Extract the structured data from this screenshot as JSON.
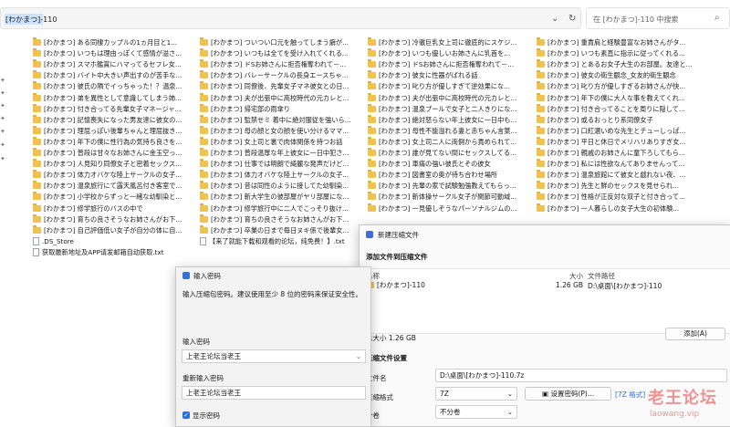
{
  "explorer": {
    "address_selected": "[わかまつ]",
    "address_rest": "-110",
    "search_placeholder": "在 [わかまつ]-110 中搜索",
    "icons": [
      "chevron-down-icon",
      "refresh-icon",
      "search-icon"
    ]
  },
  "files": {
    "col1": [
      "[わかまつ] ある同棲カップルの1ヵ月目と1...",
      "[わかまつ] いつもは理由っぽくて感情が溢さ...",
      "[わかまつ] スマホ鑑賞にハマってるセフレ女...",
      "[わかまつ] バイト中大きい声出すのが苦手な...",
      "[わかまつ] 彼氏の隣でイっちゃった！？温泉...",
      "[わかまつ] 弟を異性として意識してしまう姉...",
      "[わかまつ] 付き合ってる先輩女子マネージャ...",
      "[わかまつ] 記憶喪失になった男友達に彼女の...",
      "[わかまつ] 理屈っぽい後輩ちゃんと理屈抜き...",
      "[わかまつ] 年下の僕に性行為の気持ち良さを...",
      "[わかまつ] 普段は甘々なお姉さんに金玉空っ...",
      "[わかまつ] 人見知り同僚女子と密着セックス...",
      "[わかまつ] 体力オバケな陸上サークルの女子...",
      "[わかまつ] 温泉旅行にて露天風呂付き客室で...",
      "[わかまつ] 小学校からずっと一緒な幼馴染と...",
      "[わかまつ] 修学旅行のバスの中で",
      "[わかまつ] 育ちの良さそうなお姉さんがお下...",
      "[わかまつ] 自己評価低い女子が自分の体に自..."
    ],
    "col1_extra": [
      ".DS_Store",
      "获取最新地址及APP请发邮箱自动获取.txt"
    ],
    "col2": [
      "[わかまつ] ついつい口元を触ってしまう癖が...",
      "[わかまつ] いつもは全てを受け入れてくれる...",
      "[わかまつ] ドSお姉さんに拒否権奪われて－...",
      "[わかまつ] バレーサークルの長身エースちゃ...",
      "[わかまつ] 同僚後、先輩女子マネ彼女との日...",
      "[わかまつ] 夫が出張中に高校時代の元カレと...",
      "[わかまつ] 帰宅部の雨傘り",
      "[わかまつ] 監禁せミ 着中に絶対服従を強いら...",
      "[わかまつ] 母の顔と女の顔を使い分けるママ...",
      "[わかまつ] 女上司と裏で肉体関係を持つお話",
      "[わかまつ] 普段温厚な年上彼女に一日中犯さ...",
      "[わかまつ] 仕事では明朗で綺麗な発声だけど...",
      "[わかまつ] 体力オバケな陸上サークルの女子...",
      "[わかまつ] 昔は同性のように接してた幼馴染...",
      "[わかまつ] 新大学生の彼部屋がヤリ部屋にな...",
      "[わかまつ] 修学旅行中に二人でこっそり抜け...",
      "[わかまつ] 育ちの良さそうなお姉さんがお下...",
      "[わかまつ] 卒業の日まで毎日ヌキ係で後輩女..."
    ],
    "col2_extra": "【来了就能下载和观看的论坛，纯免费！】.txt",
    "col3": [
      "[わかまつ] 冷徹巨乳女上司に徹底的にスケジ...",
      "[わかまつ] いつも優しいお姉さんに乳首を...",
      "[わかまつ] ドSお姉さんに拒否権奪われて－...",
      "[わかまつ] 彼女に性器がばれる話",
      "[わかまつ] 叱り方が優しすぎて逆効果にな...",
      "[わかまつ] 夫が出張中に高校時代の元カレと...",
      "[わかまつ] 温泉プールで女子と二人きりにな...",
      "[わかまつ] 絶対怒らない年上彼女に一日中も...",
      "[わかまつ] 母性不能溢れる妻と赤ちゃん言葉...",
      "[わかまつ] 女上司二人に両側から責められて...",
      "[わかまつ] 誰が見てない間にセックスしてる...",
      "[わかまつ] 車痛の強い彼氏とその彼女",
      "[わかまつ] 図書室の奥が待ち合わせ場所",
      "[わかまつ] 先輩の家で試験勉強教えてもらっ...",
      "[わかまつ] 新体操サークル女子が関節可動域...",
      "[わかまつ] 一見優しそうなパーソナルジムの..."
    ],
    "col4": [
      "[わかまつ] 重責肩と経験豊富なお姉さんがタ...",
      "[わかまつ] いつも素直に指示に従ってくれる...",
      "[わかまつ] とあるお女子大生のお部屋。友達と...",
      "[わかまつ] 彼女の衛生観念_女友的衛生観念",
      "[わかまつ] 叱り方が優しすぎるお姉さんが快...",
      "[わかまつ] 年下の僕に大人な事を教えてくれ...",
      "[わかまつ] 付き合ってることを周りに隠して...",
      "[わかまつ] 或るおっとり系同僚女子",
      "[わかまつ] 口紅濃いめな先生とチューしっぱ...",
      "[わかまつ] 平日と休日でメリハリありすぎ女...",
      "[わかまつ] 親戚のお姉さんに童下ろしてもら...",
      "[わかまつ] 私には性欲なんてありませんって...",
      "[わかまつ] 温泉旅館にて彼女と戯れない夜、...",
      "[わかまつ] 先生と鮮のセックスを見せられ...",
      "[わかまつ] 性格が正反対な双子と付き合って...",
      "[わかまつ] 一人暮らしの女子大生の初体験..."
    ]
  },
  "password_dialog": {
    "title": "输入密码",
    "hint": "输入压缩包密码。建议使用至少 8 位的密码来保证安全性。",
    "password_label": "输入密码",
    "password_value": "上老王论坛当老王",
    "reenter_label": "重新输入密码",
    "reenter_value": "上老王论坛当老王",
    "show_password": "显示密码"
  },
  "archive_dialog": {
    "title": "新建压缩文件",
    "section_add": "添加文件到压缩文件",
    "columns": [
      "名称",
      "大小",
      "文件路径"
    ],
    "row": {
      "name": "[わかまつ]-110",
      "size": "1.26 GB",
      "path": "D:\\桌面\\[わかまつ]-110"
    },
    "total_size": "总大小 1.26 GB",
    "add_button": "添加(A)",
    "section_settings": "压缩文件设置",
    "filename_label": "文件名",
    "filename_value": "D:\\桌面\\[わかまつ]-110.7z",
    "format_label": "压缩格式",
    "format_value": "7Z",
    "set_password_button": "设置密码(P)...",
    "encryption_tag": "[7Z 格式]",
    "split_label": "分卷",
    "split_value": "不分卷"
  },
  "watermark": {
    "line1": "老王论坛",
    "line2": "laowang.vip"
  },
  "colors": {
    "folder": "#f0c24f",
    "selection": "#cfe3ff",
    "accent": "#2d6de0",
    "watermark": "#e63c3c"
  }
}
